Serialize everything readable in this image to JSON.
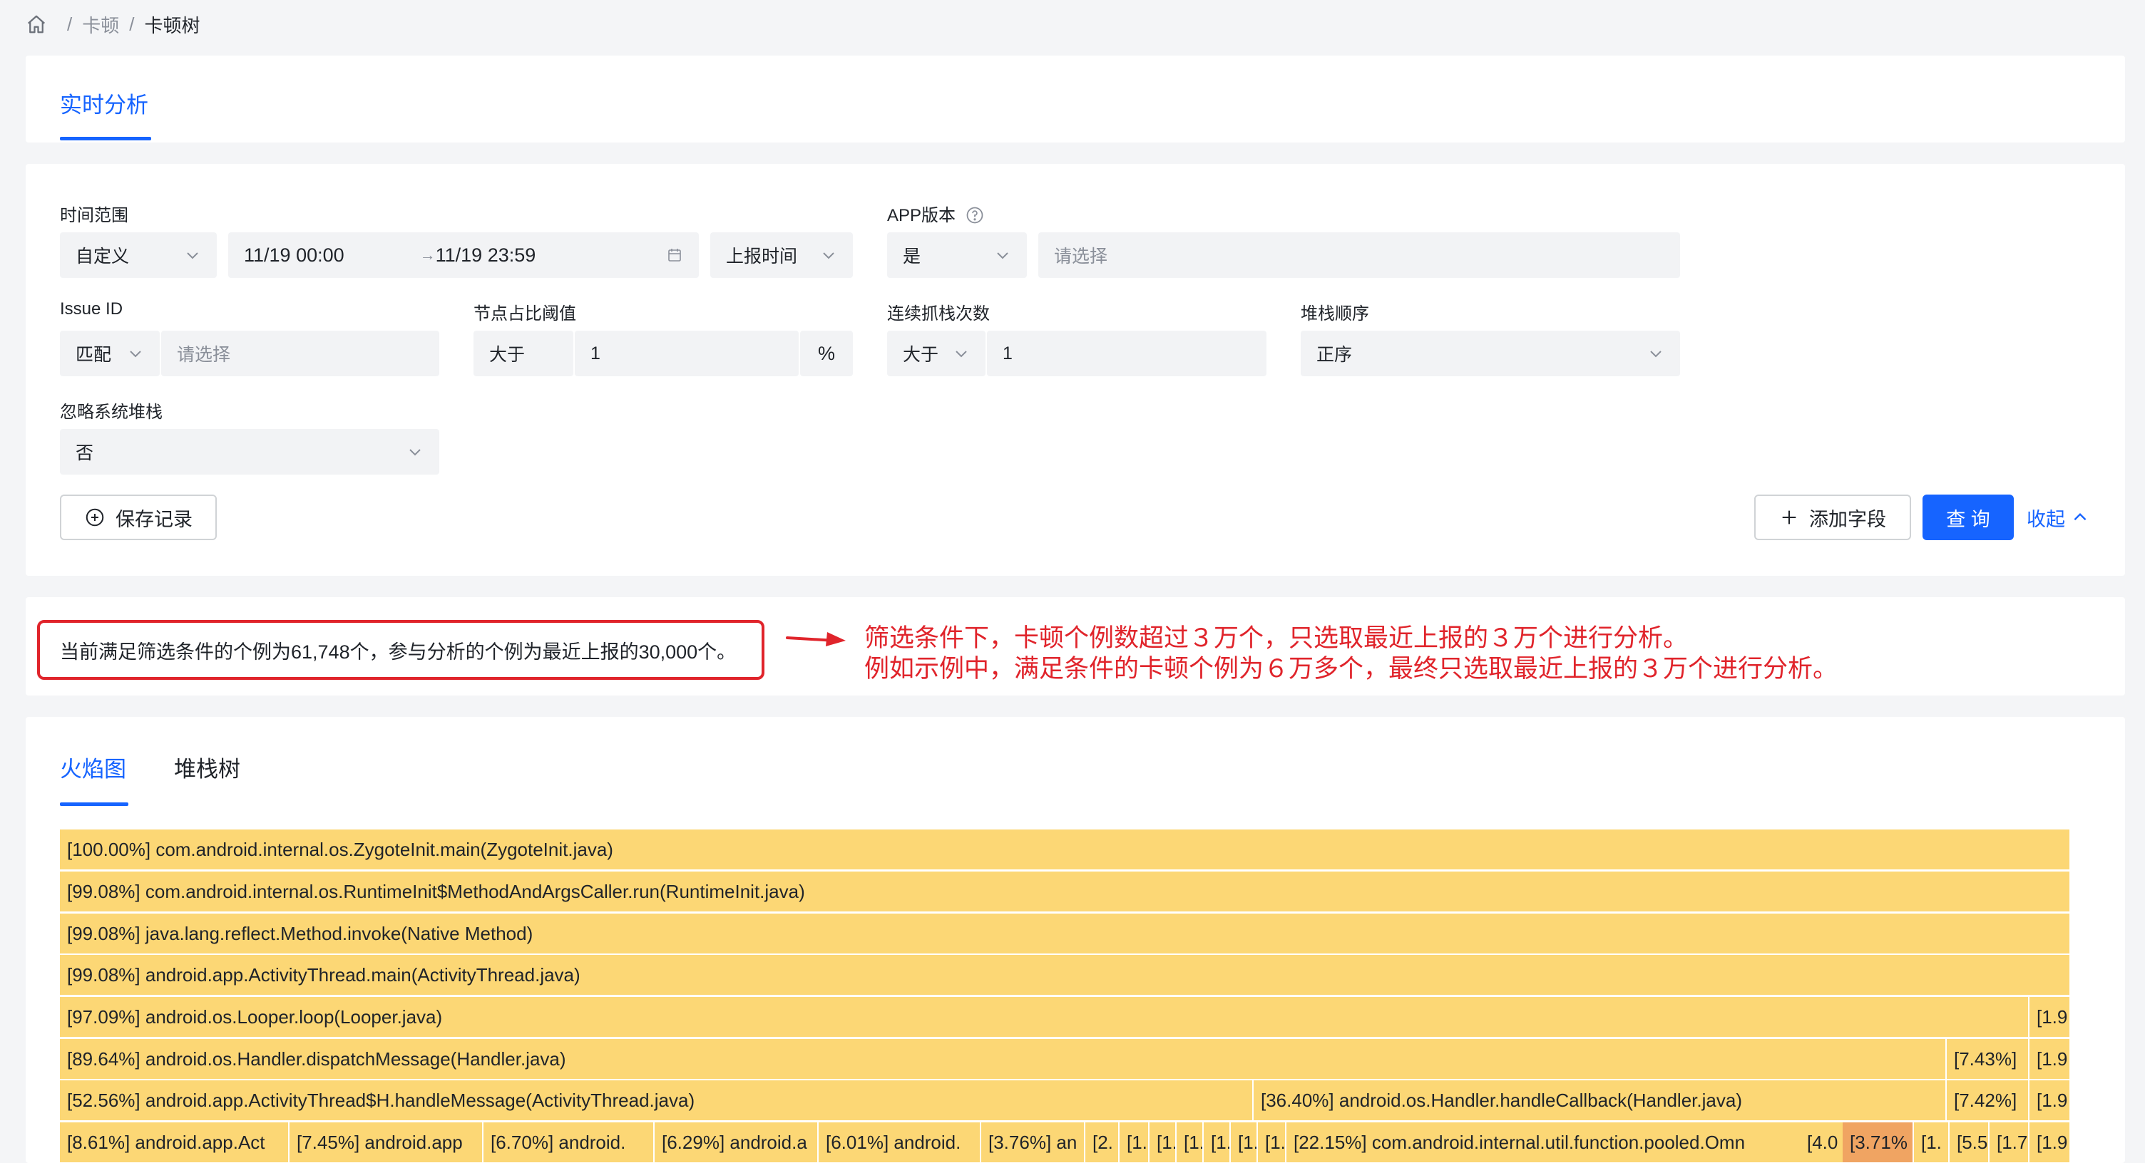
{
  "breadcrumb": {
    "items": [
      "卡顿",
      "卡顿树"
    ],
    "separator": "/"
  },
  "tabs": {
    "top": "实时分析"
  },
  "filters": {
    "time_range": {
      "label": "时间范围",
      "mode": "自定义",
      "start": "11/19 00:00",
      "arrow": "→",
      "end": "11/19 23:59",
      "time_type": "上报时间"
    },
    "app_version": {
      "label": "APP版本",
      "mode": "是",
      "placeholder": "请选择"
    },
    "issue_id": {
      "label": "Issue ID",
      "mode": "匹配",
      "placeholder": "请选择"
    },
    "node_ratio": {
      "label": "节点占比阈值",
      "op": "大于",
      "value": "1",
      "unit": "%"
    },
    "consecutive": {
      "label": "连续抓栈次数",
      "op": "大于",
      "value": "1"
    },
    "stack_order": {
      "label": "堆栈顺序",
      "value": "正序"
    },
    "ignore_system": {
      "label": "忽略系统堆栈",
      "value": "否"
    }
  },
  "actions": {
    "save": "保存记录",
    "add_field": "添加字段",
    "query": "查 询",
    "collapse": "收起"
  },
  "info": {
    "summary": "当前满足筛选条件的个例为61,748个，参与分析的个例为最近上报的30,000个。",
    "annotation_line1": "筛选条件下，卡顿个例数超过３万个，只选取最近上报的３万个进行分析。",
    "annotation_line2": "例如示例中，满足条件的卡顿个例为６万多个，最终只选取最近上报的３万个进行分析。"
  },
  "flame_tabs": [
    "火焰图",
    "堆栈树"
  ],
  "flame": {
    "rows": [
      [
        "[100.00%] com.android.internal.os.ZygoteInit.main(ZygoteInit.java)"
      ],
      [
        "[99.08%] com.android.internal.os.RuntimeInit$MethodAndArgsCaller.run(RuntimeInit.java)"
      ],
      [
        "[99.08%] java.lang.reflect.Method.invoke(Native Method)"
      ],
      [
        "[99.08%] android.app.ActivityThread.main(ActivityThread.java)"
      ],
      [
        "[97.09%] android.os.Looper.loop(Looper.java)",
        "[1.9"
      ],
      [
        "[89.64%] android.os.Handler.dispatchMessage(Handler.java)",
        "[7.43%]",
        "[1.9"
      ],
      [
        "[52.56%] android.app.ActivityThread$H.handleMessage(ActivityThread.java)",
        "[36.40%] android.os.Handler.handleCallback(Handler.java)",
        "[7.42%]",
        "[1.9"
      ],
      [
        "[8.61%] android.app.Act",
        "[7.45%] android.app",
        "[6.70%] android.",
        "[6.29%] android.a",
        "[6.01%] android.",
        "[3.76%] an",
        "[2.",
        "[1.",
        "[1.",
        "[1.",
        "[1.",
        "[1.",
        "[22.15%] com.android.internal.util.function.pooled.Omn",
        "[4.0",
        "[3.71%",
        "[1.",
        "[5.5",
        "[1.7",
        "[1.9"
      ]
    ]
  },
  "colors": {
    "accent": "#1664ff",
    "flame": "#fcd775",
    "flame_hot": "#f0a462",
    "alert": "#e0242b"
  }
}
